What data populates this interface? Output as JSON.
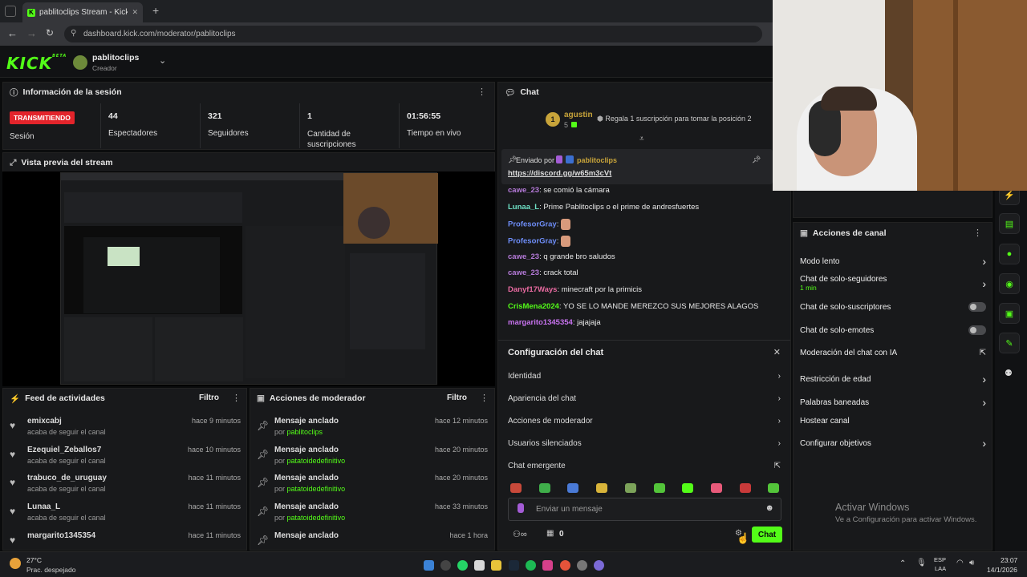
{
  "browser": {
    "tab_title": "pablitoclips Stream - Kick Dashb",
    "url": "dashboard.kick.com/moderator/pablitoclips",
    "new_tab": "+",
    "close": "✕"
  },
  "header": {
    "logo": "KICK",
    "beta": "BETA",
    "channel_name": "pablitoclips",
    "channel_role": "Creador"
  },
  "session": {
    "title": "Información de la sesión",
    "badge": "TRANSMITIENDO",
    "badge_label": "Sesión",
    "stats": [
      {
        "value": "44",
        "label": "Espectadores"
      },
      {
        "value": "321",
        "label": "Seguidores"
      },
      {
        "value": "1",
        "label": "Cantidad de suscripciones"
      },
      {
        "value": "01:56:55",
        "label": "Tiempo en vivo"
      }
    ]
  },
  "preview": {
    "title": "Vista previa del stream"
  },
  "activity_feed": {
    "title": "Feed de actividades",
    "filter": "Filtro",
    "items": [
      {
        "name": "emixcabj",
        "sub": "acaba de seguir el canal",
        "time": "hace 9 minutos"
      },
      {
        "name": "Ezequiel_Zeballos7",
        "sub": "acaba de seguir el canal",
        "time": "hace 10 minutos"
      },
      {
        "name": "trabuco_de_uruguay",
        "sub": "acaba de seguir el canal",
        "time": "hace 11 minutos"
      },
      {
        "name": "Lunaa_L",
        "sub": "acaba de seguir el canal",
        "time": "hace 11 minutos"
      },
      {
        "name": "margarito1345354",
        "sub": "",
        "time": "hace 11 minutos"
      }
    ]
  },
  "mod_actions": {
    "title": "Acciones de moderador",
    "filter": "Filtro",
    "items": [
      {
        "name": "Mensaje anclado",
        "by": "por",
        "user": "pablitoclips",
        "time": "hace 12 minutos"
      },
      {
        "name": "Mensaje anclado",
        "by": "por",
        "user": "patatoidedefinitivo",
        "time": "hace 20 minutos"
      },
      {
        "name": "Mensaje anclado",
        "by": "por",
        "user": "patatoidedefinitivo",
        "time": "hace 20 minutos"
      },
      {
        "name": "Mensaje anclado",
        "by": "por",
        "user": "patatoidedefinitivo",
        "time": "hace 33 minutos"
      },
      {
        "name": "Mensaje anclado",
        "by": "",
        "user": "",
        "time": "hace 1 hora"
      }
    ]
  },
  "chat": {
    "title": "Chat",
    "top_gifter": {
      "rank": "1",
      "name": "agustin",
      "count": "5",
      "cta": "Regala 1 suscripción para tomar la posición 2"
    },
    "pinned": {
      "label": "Enviado por",
      "user": "pablitoclips",
      "link": "https://discord.gg/w65m3cVt"
    },
    "messages": [
      {
        "user": "cawe_23",
        "text": "se comió la cámara",
        "color": "#b57ad9"
      },
      {
        "user": "Lunaa_L",
        "text": "Prime Pablitoclips o el prime de andresfuertes",
        "color": "#6fe3c7"
      },
      {
        "user": "ProfesorGray",
        "text": "",
        "color": "#6d8cf5"
      },
      {
        "user": "ProfesorGray",
        "text": "",
        "color": "#6d8cf5"
      },
      {
        "user": "cawe_23",
        "text": "q grande bro saludos",
        "color": "#b57ad9"
      },
      {
        "user": "cawe_23",
        "text": "crack total",
        "color": "#b57ad9"
      },
      {
        "user": "Danyf17Ways",
        "text": "minecraft por la primicis",
        "color": "#e86aa0"
      },
      {
        "user": "CrisMena2024",
        "text": "YO SE LO MANDE MEREZCO SUS MEJORES ALAGOS",
        "color": "#53fc18"
      },
      {
        "user": "margarito1345354",
        "text": "jajajaja",
        "color": "#c873f0"
      }
    ],
    "settings": {
      "title": "Configuración del chat",
      "items": [
        "Identidad",
        "Apariencia del chat",
        "Acciones de moderador",
        "Usuarios silenciados",
        "Chat emergente"
      ]
    },
    "input_placeholder": "Enviar un mensaje",
    "viewers_count": "0",
    "send_label": "Chat"
  },
  "channel_actions": {
    "title": "Acciones de canal",
    "items": [
      {
        "label": "Modo lento",
        "sub": "",
        "control": "chevron"
      },
      {
        "label": "Chat de solo-seguidores",
        "sub": "1 min",
        "control": "chevron"
      },
      {
        "label": "Chat de solo-suscriptores",
        "sub": "",
        "control": "toggle"
      },
      {
        "label": "Chat de solo-emotes",
        "sub": "",
        "control": "toggle"
      },
      {
        "label": "Moderación del chat con IA",
        "sub": "",
        "control": "external"
      },
      {
        "label": "Restricción de edad",
        "sub": "",
        "control": "chevron"
      },
      {
        "label": "Palabras baneadas",
        "sub": "",
        "control": "chevron"
      },
      {
        "label": "Hostear canal",
        "sub": "",
        "control": "none"
      },
      {
        "label": "Configurar objetivos",
        "sub": "",
        "control": "chevron"
      }
    ]
  },
  "watermark": {
    "title": "Activar Windows",
    "sub": "Ve a Configuración para activar Windows."
  },
  "taskbar": {
    "temp": "27°C",
    "weather": "Prac. despejado",
    "lang1": "ESP",
    "lang2": "LAA",
    "time": "23:07",
    "date": "14/1/2026"
  }
}
